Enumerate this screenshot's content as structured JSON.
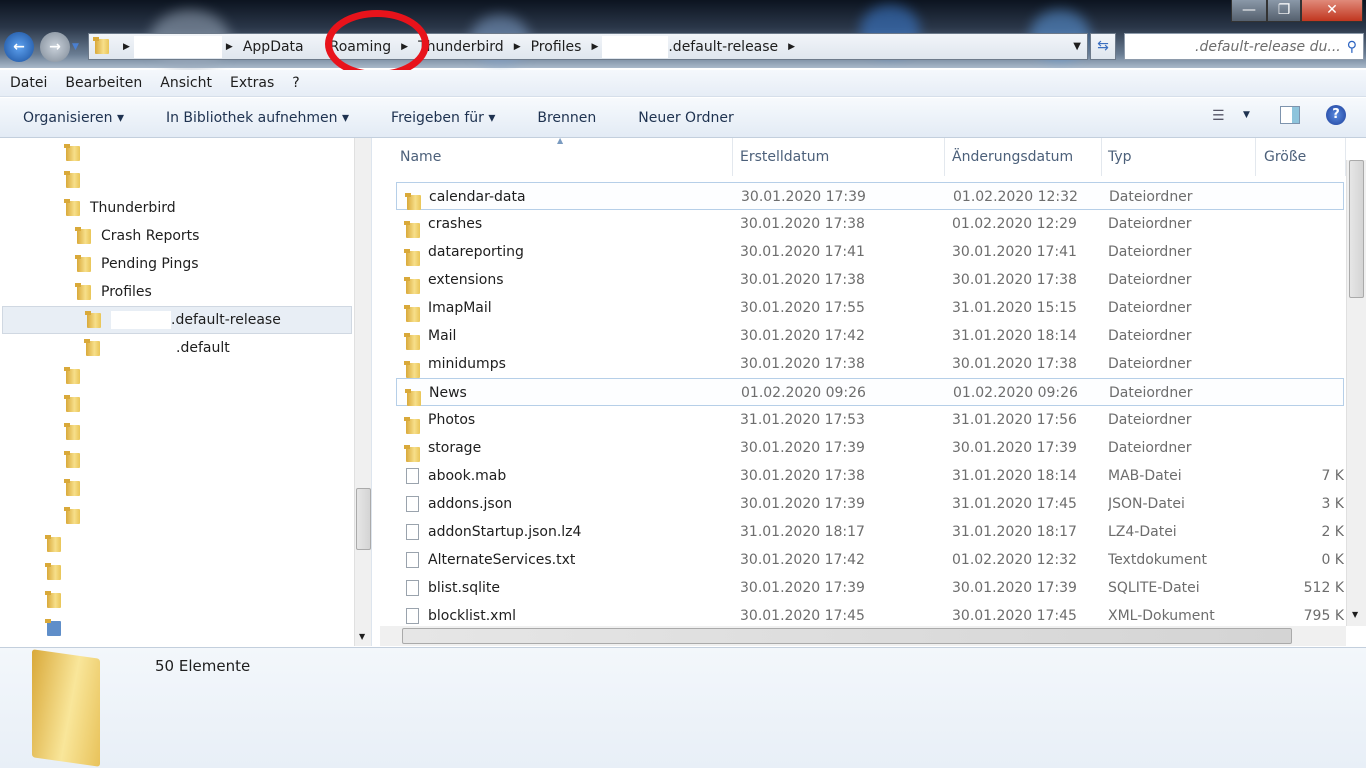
{
  "window": {
    "minimize": "—",
    "maximize": "❐",
    "close": "✕"
  },
  "address": {
    "crumbs": [
      "AppData",
      "Roaming",
      "Thunderbird",
      "Profiles",
      ".default-release"
    ]
  },
  "search": {
    "placeholder": ".default-release du..."
  },
  "menu": [
    "Datei",
    "Bearbeiten",
    "Ansicht",
    "Extras",
    "?"
  ],
  "toolbar": {
    "organize": "Organisieren ▾",
    "library": "In Bibliothek aufnehmen ▾",
    "share": "Freigeben für ▾",
    "burn": "Brennen",
    "new_folder": "Neuer Ordner"
  },
  "nav": {
    "thunderbird": "Thunderbird",
    "crash_reports": "Crash Reports",
    "pending_pings": "Pending Pings",
    "profiles": "Profiles",
    "default_release": ".default-release",
    "default": ".default"
  },
  "columns": {
    "name": "Name",
    "created": "Erstelldatum",
    "modified": "Änderungsdatum",
    "type": "Typ",
    "size": "Größe"
  },
  "files": [
    {
      "name": "calendar-data",
      "created": "30.01.2020 17:39",
      "modified": "01.02.2020 12:32",
      "type": "Dateiordner",
      "size": "",
      "folder": true
    },
    {
      "name": "crashes",
      "created": "30.01.2020 17:38",
      "modified": "01.02.2020 12:29",
      "type": "Dateiordner",
      "size": "",
      "folder": true
    },
    {
      "name": "datareporting",
      "created": "30.01.2020 17:41",
      "modified": "30.01.2020 17:41",
      "type": "Dateiordner",
      "size": "",
      "folder": true
    },
    {
      "name": "extensions",
      "created": "30.01.2020 17:38",
      "modified": "30.01.2020 17:38",
      "type": "Dateiordner",
      "size": "",
      "folder": true
    },
    {
      "name": "ImapMail",
      "created": "30.01.2020 17:55",
      "modified": "31.01.2020 15:15",
      "type": "Dateiordner",
      "size": "",
      "folder": true
    },
    {
      "name": "Mail",
      "created": "30.01.2020 17:42",
      "modified": "31.01.2020 18:14",
      "type": "Dateiordner",
      "size": "",
      "folder": true
    },
    {
      "name": "minidumps",
      "created": "30.01.2020 17:38",
      "modified": "30.01.2020 17:38",
      "type": "Dateiordner",
      "size": "",
      "folder": true
    },
    {
      "name": "News",
      "created": "01.02.2020 09:26",
      "modified": "01.02.2020 09:26",
      "type": "Dateiordner",
      "size": "",
      "folder": true
    },
    {
      "name": "Photos",
      "created": "31.01.2020 17:53",
      "modified": "31.01.2020 17:56",
      "type": "Dateiordner",
      "size": "",
      "folder": true
    },
    {
      "name": "storage",
      "created": "30.01.2020 17:39",
      "modified": "30.01.2020 17:39",
      "type": "Dateiordner",
      "size": "",
      "folder": true
    },
    {
      "name": "abook.mab",
      "created": "30.01.2020 17:38",
      "modified": "31.01.2020 18:14",
      "type": "MAB-Datei",
      "size": "7 K",
      "folder": false
    },
    {
      "name": "addons.json",
      "created": "30.01.2020 17:39",
      "modified": "31.01.2020 17:45",
      "type": "JSON-Datei",
      "size": "3 K",
      "folder": false
    },
    {
      "name": "addonStartup.json.lz4",
      "created": "31.01.2020 18:17",
      "modified": "31.01.2020 18:17",
      "type": "LZ4-Datei",
      "size": "2 K",
      "folder": false
    },
    {
      "name": "AlternateServices.txt",
      "created": "30.01.2020 17:42",
      "modified": "01.02.2020 12:32",
      "type": "Textdokument",
      "size": "0 K",
      "folder": false
    },
    {
      "name": "blist.sqlite",
      "created": "30.01.2020 17:39",
      "modified": "30.01.2020 17:39",
      "type": "SQLITE-Datei",
      "size": "512 K",
      "folder": false
    },
    {
      "name": "blocklist.xml",
      "created": "30.01.2020 17:45",
      "modified": "30.01.2020 17:45",
      "type": "XML-Dokument",
      "size": "795 K",
      "folder": false
    }
  ],
  "status": {
    "count": "50 Elemente"
  }
}
